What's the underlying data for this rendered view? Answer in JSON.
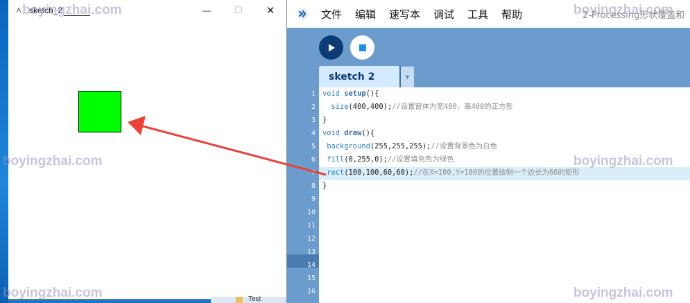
{
  "ide": {
    "menu": [
      "文件",
      "编辑",
      "速写本",
      "调试",
      "工具",
      "帮助"
    ],
    "window_title": "2-Processing形状覆盖和",
    "tab_label": "sketch 2",
    "code_lines": [
      "void setup(){",
      "  size(400,400);//设置窗体为宽400，高400的正方形",
      "}",
      "void draw(){",
      " background(255,255,255);//设置背景色为白色",
      " fill(0,255,0);//设置填充色为绿色",
      " rect(100,100,60,60);//在X=100,Y=100的位置绘制一个边长为60的矩形",
      "}",
      "",
      "",
      "",
      "",
      "",
      "",
      "",
      ""
    ],
    "line_numbers": [
      "1",
      "2",
      "3",
      "4",
      "5",
      "6",
      "7",
      "8",
      "9",
      "10",
      "11",
      "12",
      "13",
      "14",
      "15",
      "16"
    ],
    "highlighted_line": 7
  },
  "sketch_window": {
    "title": "sketch_2",
    "square_color": "#00ff00",
    "minimize": "—",
    "maximize": "☐",
    "close": "✕"
  },
  "taskbar": {
    "folder_label": "Test"
  },
  "watermark": "boyingzhai.com",
  "colors": {
    "ide_bg": "#6b9ccd",
    "run_button": "#0d3b75",
    "tab_bg": "#d4ebff",
    "arrow": "#e8433a",
    "keyword": "#2e7dbe",
    "comment": "#8c8c8c"
  }
}
